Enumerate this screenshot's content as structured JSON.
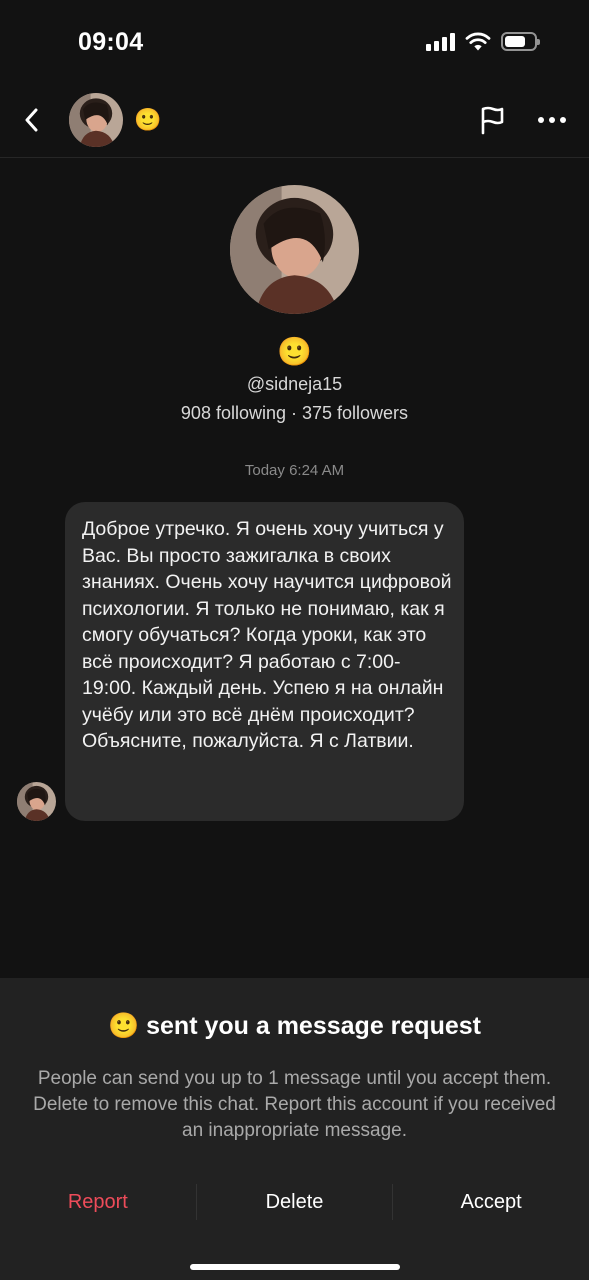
{
  "status_bar": {
    "time": "09:04",
    "battery_level": 0.7,
    "icons": [
      "signal-icon",
      "wifi-icon",
      "battery-icon"
    ]
  },
  "header": {
    "contact_emoji": "🙂",
    "icons": [
      "back-chevron-icon",
      "flag-icon",
      "more-dots-icon"
    ]
  },
  "profile": {
    "emoji": "🙂",
    "username": "@sidneja15",
    "stats": "908 following · 375 followers"
  },
  "conversation": {
    "timestamp": "Today 6:24 AM",
    "messages": [
      {
        "text": "Доброе утречко. Я очень хочу учиться у Вас. Вы просто зажигалка в своих знаниях. Очень хочу научится цифровой психологии. Я только не понимаю, как я смогу обучаться? Когда уроки, как это всё происходит? Я работаю с 7:00-19:00. Каждый день. Успею я на онлайн учёбу или это всё днём происходит? Объясните, пожалуйста. Я с Латвии."
      }
    ]
  },
  "request_panel": {
    "emoji": "🙂",
    "title": "sent you a message request",
    "description": "People can send you up to 1 message until you accept them. Delete to remove this chat. Report this account if you received an inappropriate message.",
    "report_label": "Report",
    "delete_label": "Delete",
    "accept_label": "Accept"
  },
  "colors": {
    "background": "#121212",
    "bubble": "#2b2b2b",
    "panel": "#222222",
    "report": "#ee4c5a"
  }
}
